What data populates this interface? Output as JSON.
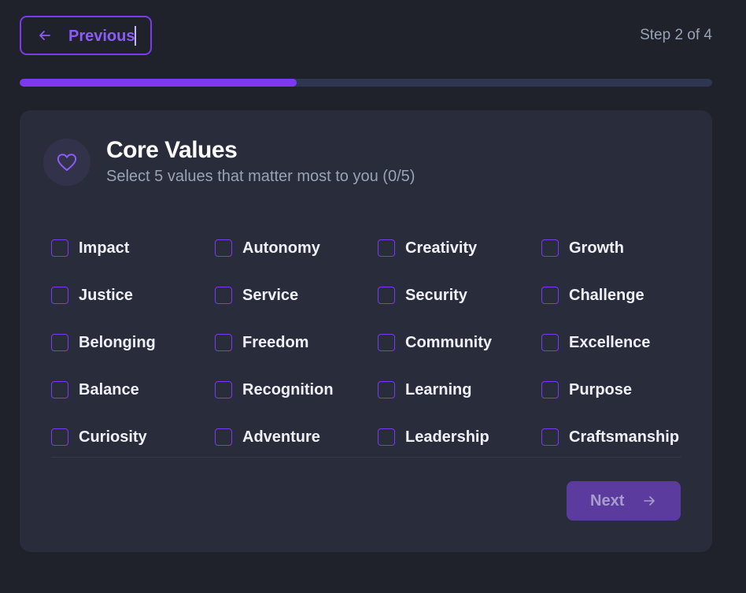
{
  "nav": {
    "previous_label": "Previous",
    "step_text": "Step 2 of 4"
  },
  "progress": {
    "value": 0.4
  },
  "card": {
    "title": "Core Values",
    "subtitle": "Select 5 values that matter most to you (0/5)",
    "icon": "heart-icon"
  },
  "values": [
    [
      "Impact",
      "Autonomy",
      "Creativity",
      "Growth"
    ],
    [
      "Justice",
      "Service",
      "Security",
      "Challenge"
    ],
    [
      "Belonging",
      "Freedom",
      "Community",
      "Excellence"
    ],
    [
      "Balance",
      "Recognition",
      "Learning",
      "Purpose"
    ],
    [
      "Curiosity",
      "Adventure",
      "Leadership",
      "Craftsmanship"
    ]
  ],
  "footer": {
    "next_label": "Next"
  },
  "colors": {
    "accent": "#7c3aed",
    "background": "#1f212b",
    "card": "#292c3a",
    "track": "#2e3650",
    "next_button": "#5b3c9e"
  }
}
